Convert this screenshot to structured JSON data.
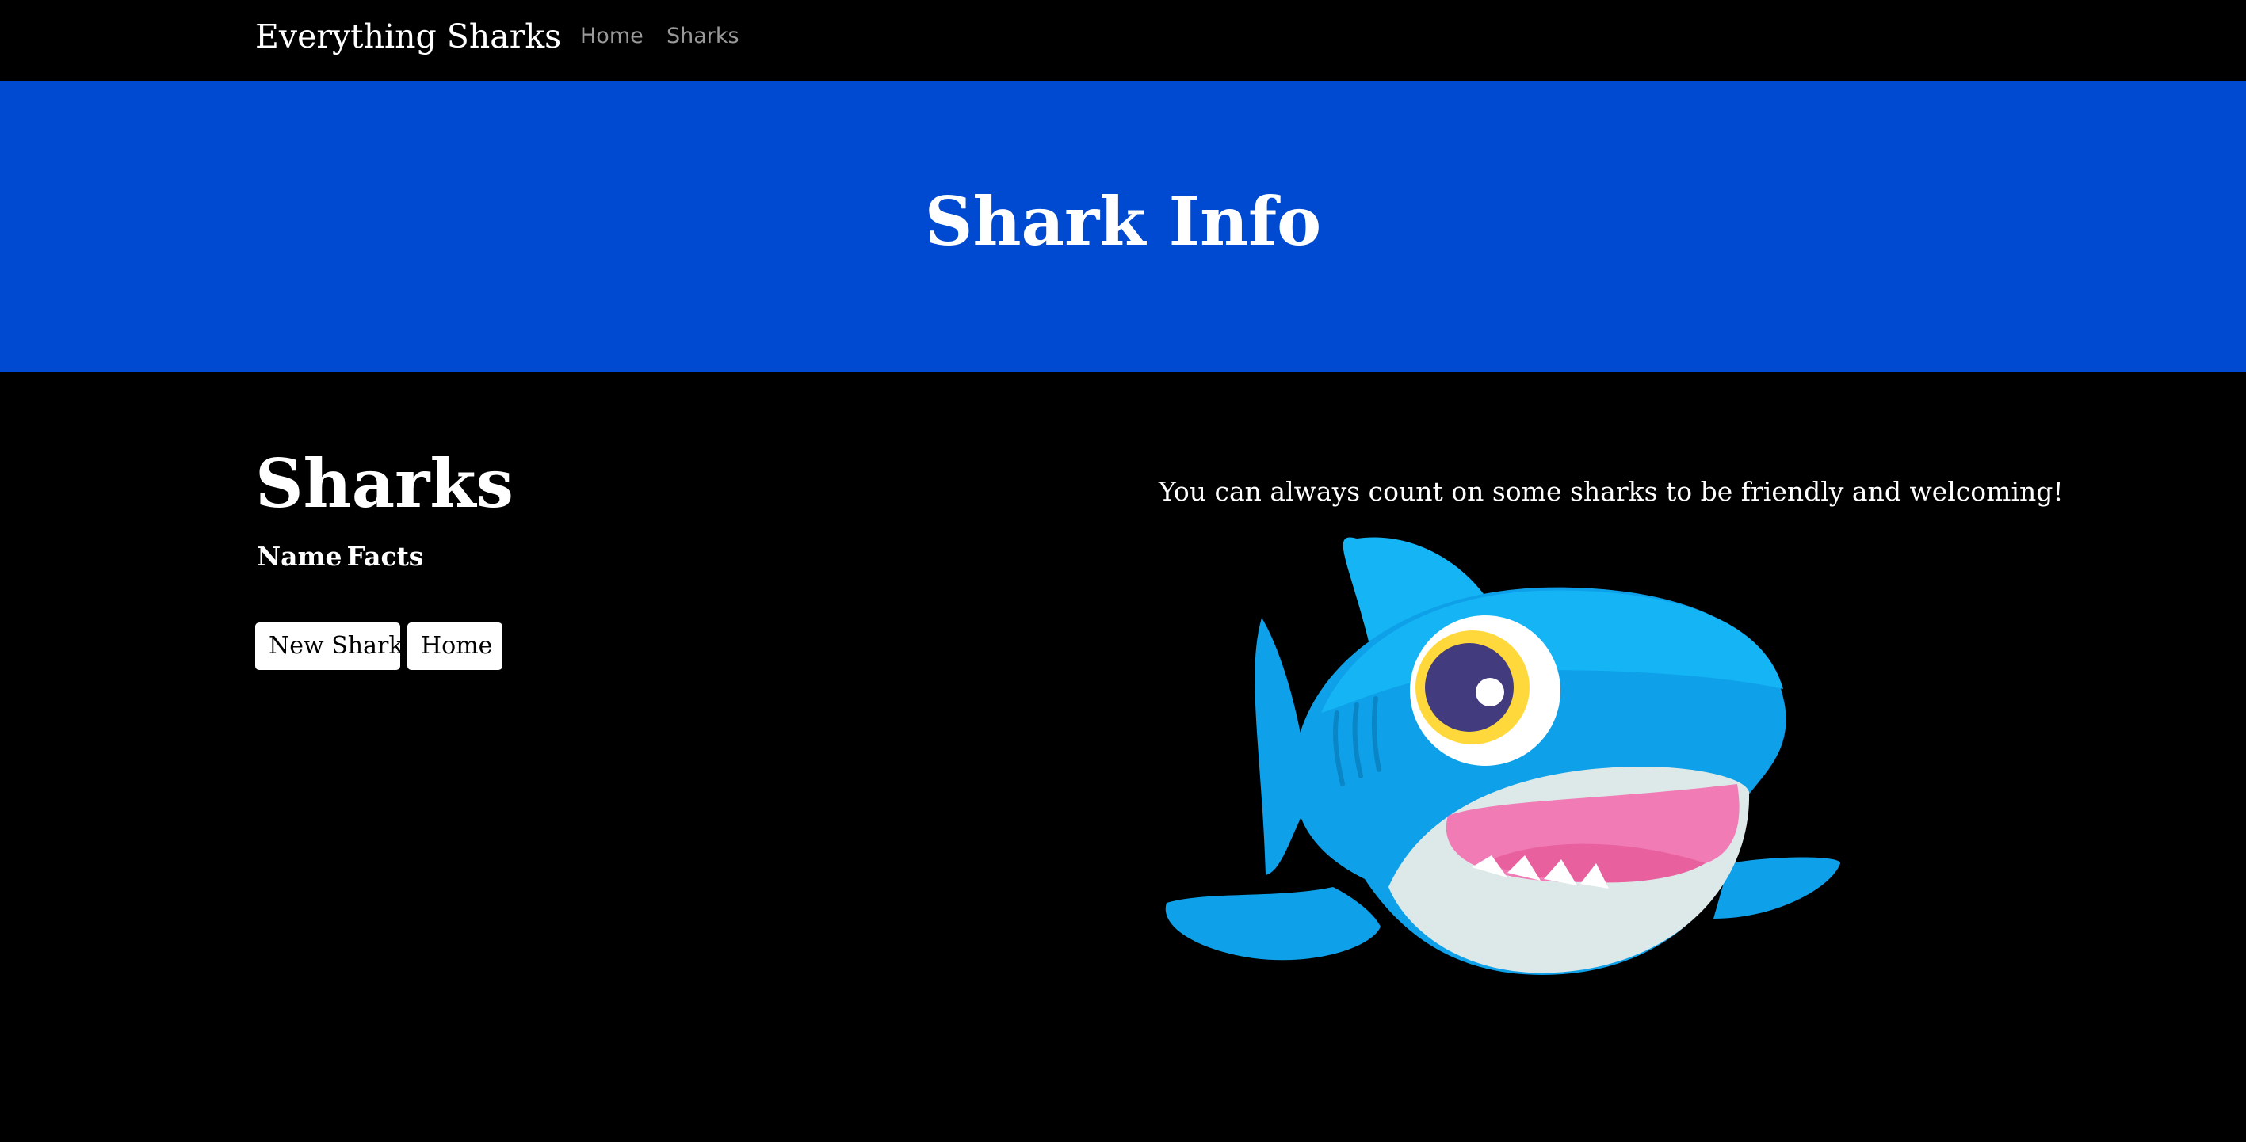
{
  "navbar": {
    "brand": "Everything Sharks",
    "links": [
      {
        "label": "Home"
      },
      {
        "label": "Sharks"
      }
    ]
  },
  "hero": {
    "title": "Shark Info"
  },
  "main": {
    "section_title": "Sharks",
    "table_headers": [
      "Name",
      "Facts"
    ],
    "buttons": {
      "new_shark": "New Shark",
      "home": "Home"
    },
    "caption": "You can always count on some sharks to be friendly and welcoming!"
  },
  "colors": {
    "page_background": "#000000",
    "hero_background": "#0049d1",
    "nav_link": "#9a9a9a",
    "shark_blue": "#0ea0e8",
    "shark_fin": "#14b4f5",
    "shark_belly": "#dde9e9",
    "shark_mouth": "#f07bb5"
  },
  "image": {
    "icon": "cartoon-shark-illustration"
  }
}
